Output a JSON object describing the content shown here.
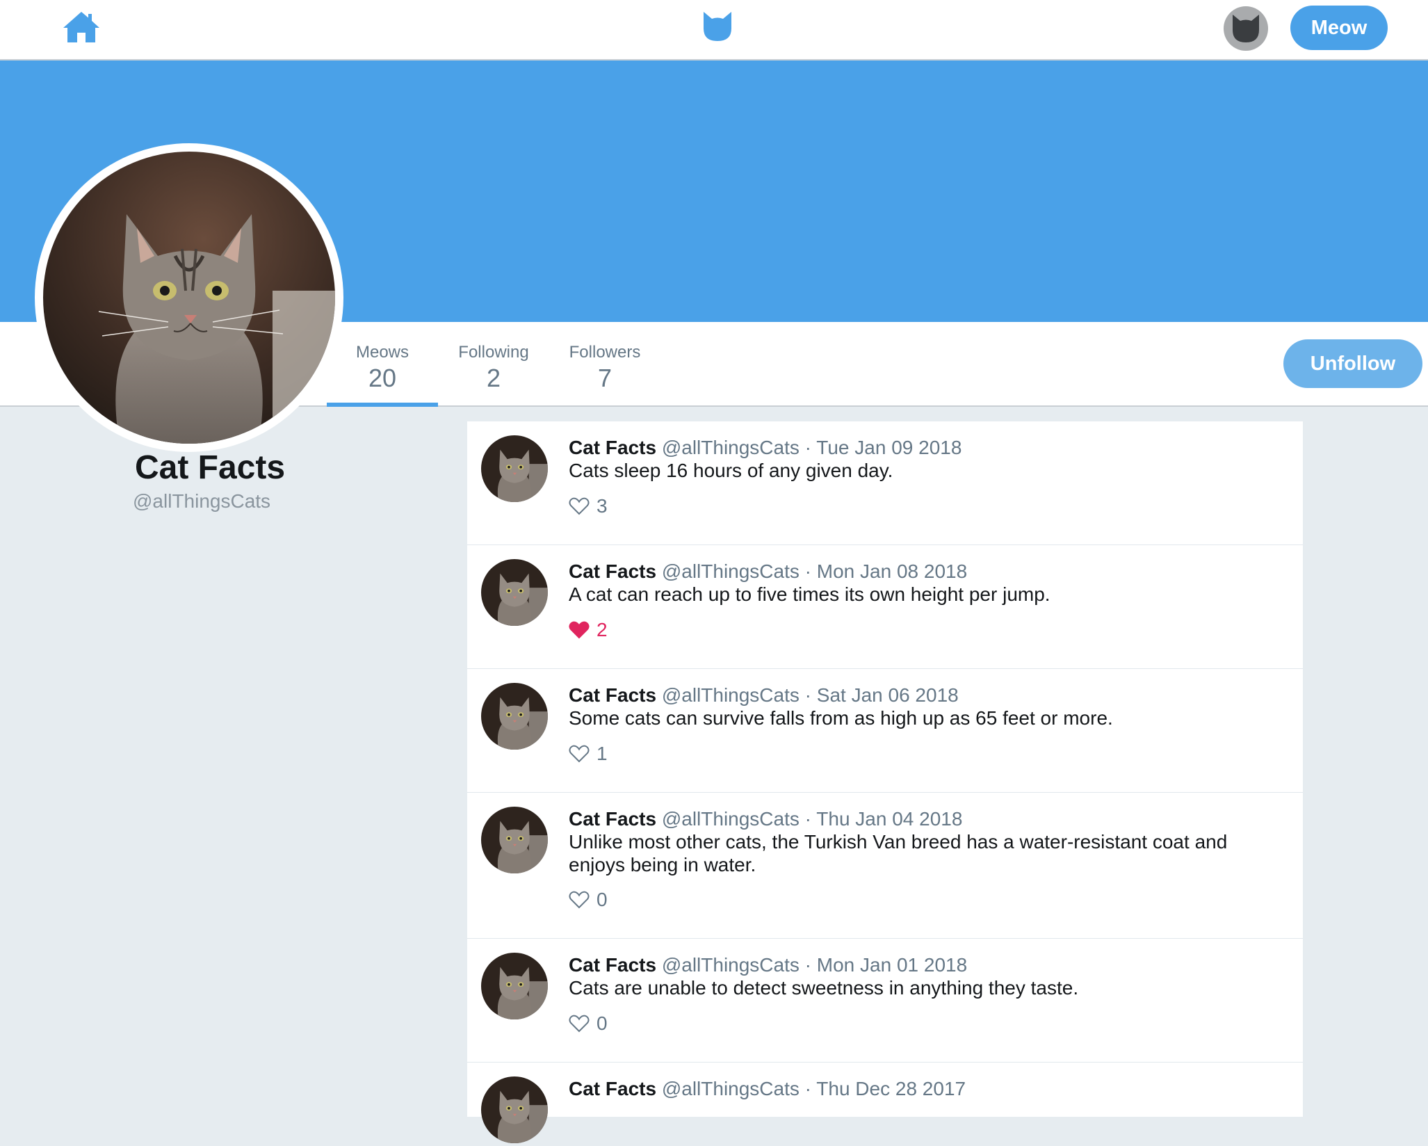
{
  "nav": {
    "home_icon": "home-icon",
    "logo_icon": "cat-logo-icon",
    "user_avatar_icon": "cat-avatar-icon",
    "meow_button": "Meow"
  },
  "profile": {
    "name": "Cat Facts",
    "handle": "@allThingsCats",
    "stats": [
      {
        "label": "Meows",
        "value": "20",
        "active": true
      },
      {
        "label": "Following",
        "value": "2",
        "active": false
      },
      {
        "label": "Followers",
        "value": "7",
        "active": false
      }
    ],
    "unfollow_button": "Unfollow"
  },
  "colors": {
    "accent": "#4aa1e8",
    "like_active": "#e0245e",
    "page_bg": "#e6ecf0"
  },
  "meows": [
    {
      "name": "Cat Facts",
      "handle": "@allThingsCats",
      "sep": "·",
      "date": "Tue Jan 09 2018",
      "text": "Cats sleep 16 hours of any given day.",
      "likes": "3",
      "liked": false
    },
    {
      "name": "Cat Facts",
      "handle": "@allThingsCats",
      "sep": "·",
      "date": "Mon Jan 08 2018",
      "text": "A cat can reach up to five times its own height per jump.",
      "likes": "2",
      "liked": true
    },
    {
      "name": "Cat Facts",
      "handle": "@allThingsCats",
      "sep": "·",
      "date": "Sat Jan 06 2018",
      "text": "Some cats can survive falls from as high up as 65 feet or more.",
      "likes": "1",
      "liked": false
    },
    {
      "name": "Cat Facts",
      "handle": "@allThingsCats",
      "sep": "·",
      "date": "Thu Jan 04 2018",
      "text": "Unlike most other cats, the Turkish Van breed has a water-resistant coat and enjoys being in water.",
      "likes": "0",
      "liked": false
    },
    {
      "name": "Cat Facts",
      "handle": "@allThingsCats",
      "sep": "·",
      "date": "Mon Jan 01 2018",
      "text": "Cats are unable to detect sweetness in anything they taste.",
      "likes": "0",
      "liked": false
    },
    {
      "name": "Cat Facts",
      "handle": "@allThingsCats",
      "sep": "·",
      "date": "Thu Dec 28 2017",
      "text": "",
      "likes": "",
      "liked": false
    }
  ]
}
